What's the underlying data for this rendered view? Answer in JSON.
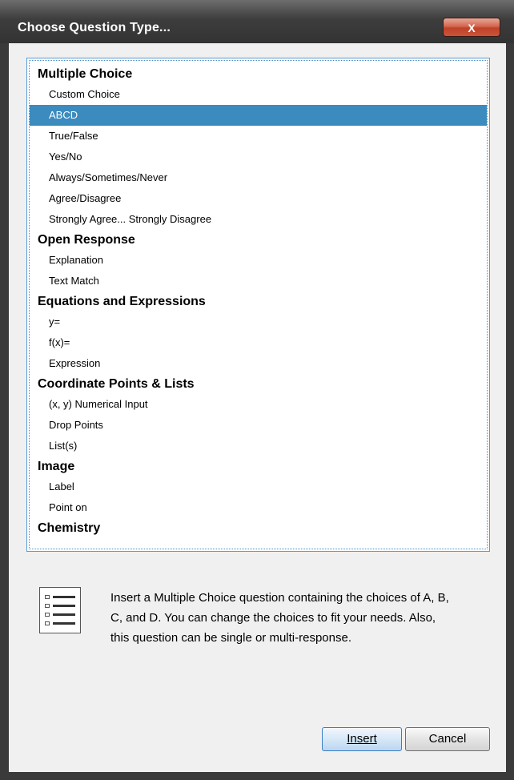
{
  "window": {
    "title": "Choose Question Type...",
    "close_label": "X"
  },
  "list": {
    "groups": [
      {
        "header": "Multiple Choice",
        "items": [
          "Custom Choice",
          "ABCD",
          "True/False",
          "Yes/No",
          "Always/Sometimes/Never",
          "Agree/Disagree",
          "Strongly Agree... Strongly Disagree"
        ]
      },
      {
        "header": "Open Response",
        "items": [
          "Explanation",
          "Text Match"
        ]
      },
      {
        "header": "Equations and Expressions",
        "items": [
          "y=",
          "f(x)=",
          "Expression"
        ]
      },
      {
        "header": "Coordinate Points & Lists",
        "items": [
          "(x, y) Numerical Input",
          "Drop Points",
          "List(s)"
        ]
      },
      {
        "header": "Image",
        "items": [
          "Label",
          "Point on"
        ]
      },
      {
        "header": "Chemistry",
        "items": []
      }
    ],
    "selected": "ABCD"
  },
  "description": {
    "icon": "list-icon",
    "text": "Insert a Multiple Choice question containing the choices of A, B, C, and D.  You can change the choices to fit your needs.  Also, this question can be single or multi-response."
  },
  "buttons": {
    "insert": "Insert",
    "cancel": "Cancel"
  },
  "colors": {
    "selection": "#3b8bbf",
    "close": "#c9553a"
  }
}
